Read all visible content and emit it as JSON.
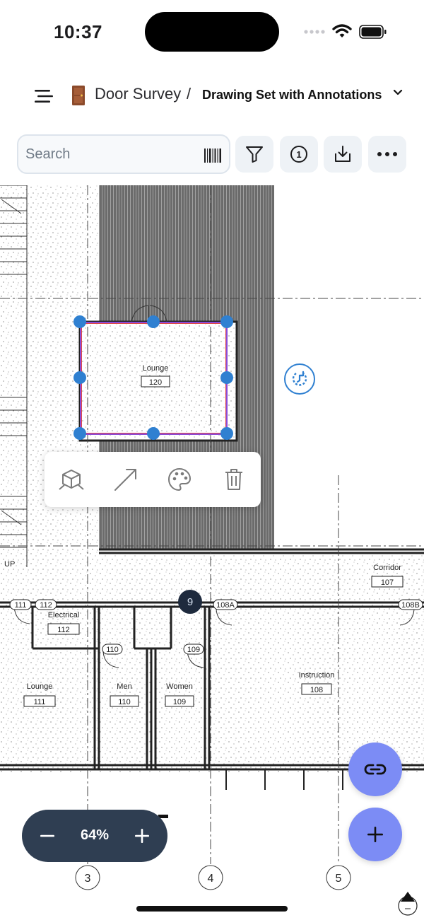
{
  "status_bar": {
    "time": "10:37"
  },
  "header": {
    "app_title": "Door Survey",
    "separator": "/",
    "drawing_title": "Drawing Set with Annotations"
  },
  "toolbar": {
    "search_placeholder": "Search",
    "info_count": "1"
  },
  "drawing": {
    "rooms": [
      {
        "name": "Lounge",
        "number": "120"
      },
      {
        "name": "Corridor",
        "number": "107"
      },
      {
        "name": "Electrical",
        "number": "112"
      },
      {
        "name": "Lounge",
        "number": "111"
      },
      {
        "name": "Men",
        "number": "110"
      },
      {
        "name": "Women",
        "number": "109"
      },
      {
        "name": "Instruction",
        "number": "108"
      }
    ],
    "door_tags": [
      "111",
      "112",
      "110",
      "109",
      "108A",
      "108B"
    ],
    "gridlines": [
      "3",
      "4",
      "5"
    ],
    "stair_label": "UP"
  },
  "context_menu": {
    "items": [
      "3d-box-icon",
      "arrow-icon",
      "palette-icon",
      "trash-icon"
    ]
  },
  "pin_badge": "9",
  "zoom": {
    "value": "64%"
  },
  "colors": {
    "accent": "#2f80d1",
    "fab": "#7c8cf5",
    "zoom_pill": "#2f3e52",
    "selection": "#8c4bd6"
  }
}
